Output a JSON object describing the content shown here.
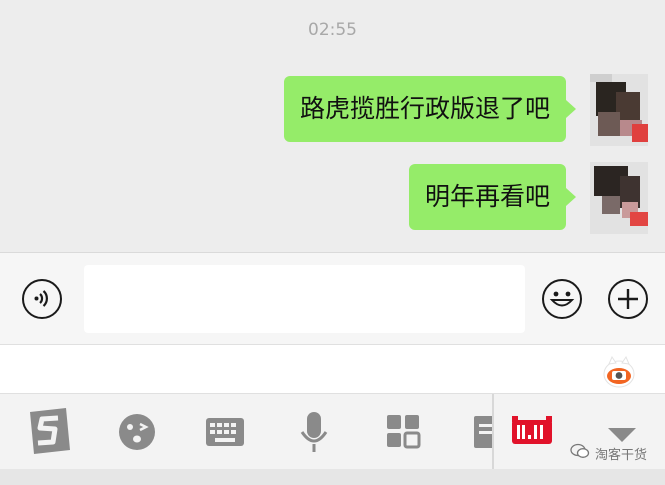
{
  "chat": {
    "timestamp": "02:55",
    "messages": [
      {
        "text": "路虎揽胜行政版退了吧",
        "sender": "self"
      },
      {
        "text": "明年再看吧",
        "sender": "self"
      }
    ]
  },
  "input_bar": {
    "voice_icon": "voice-toggle-icon",
    "text_value": "",
    "emoji_icon": "emoji-icon",
    "more_icon": "plus-icon"
  },
  "suggestion_bar": {
    "mascot_icon": "sogou-mascot-icon"
  },
  "keyboard_toolbar": {
    "items": [
      {
        "icon": "sogou-logo-icon"
      },
      {
        "icon": "wink-emoji-icon"
      },
      {
        "icon": "keyboard-icon"
      },
      {
        "icon": "microphone-icon"
      },
      {
        "icon": "app-grid-icon"
      },
      {
        "icon": "clipboard-icon"
      },
      {
        "icon": "tmall-11-11-icon"
      },
      {
        "icon": "collapse-triangle-icon"
      }
    ]
  },
  "watermark": {
    "text": "淘客干货"
  },
  "colors": {
    "background": "#ededed",
    "bubble_self": "#95ec69",
    "timestamp": "#a8a8a8",
    "tmall_red": "#e1122a",
    "sogou_orange": "#f26522"
  }
}
